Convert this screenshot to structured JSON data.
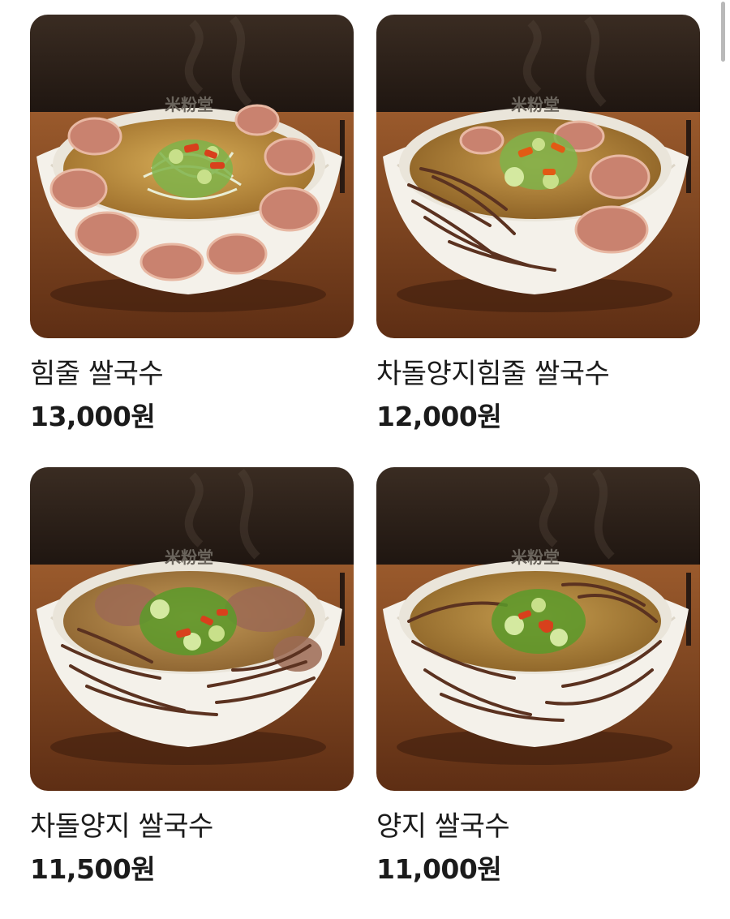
{
  "menu_items": [
    {
      "name": "힘줄 쌀국수",
      "price": "13,000원",
      "bowl_logo": "米粉堂",
      "toppings": [
        "tendon",
        "scallion",
        "chili"
      ]
    },
    {
      "name": "차돌양지힘줄 쌀국수",
      "price": "12,000원",
      "bowl_logo": "米粉堂",
      "toppings": [
        "brisket",
        "tendon",
        "scallion",
        "chili"
      ]
    },
    {
      "name": "차돌양지 쌀국수",
      "price": "11,500원",
      "bowl_logo": "米粉堂",
      "toppings": [
        "brisket",
        "scallion",
        "chili"
      ]
    },
    {
      "name": "양지 쌀국수",
      "price": "11,000원",
      "bowl_logo": "米粉堂",
      "toppings": [
        "brisket",
        "scallion",
        "chili"
      ]
    }
  ],
  "colors": {
    "background": "#ffffff",
    "text": "#1b1b1b",
    "wall": "#2b1f17",
    "table": "#7a3f1f",
    "bowl": "#f4f1ea",
    "broth": "#b88a3e",
    "scrollbar": "#b9b9b9"
  }
}
